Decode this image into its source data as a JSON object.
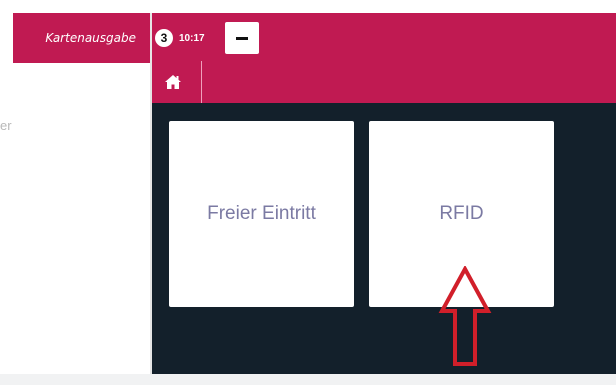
{
  "sidebar": {
    "title": "Kartenausgabe",
    "partial_text": "er"
  },
  "header": {
    "badge_count": "3",
    "time": "10:17",
    "minus_icon": "minus-icon",
    "home_icon": "home-icon"
  },
  "tiles": [
    {
      "label": "Freier Eintritt"
    },
    {
      "label": "RFID"
    }
  ],
  "annotation": {
    "arrow_icon": "up-arrow-icon",
    "arrow_color": "#d11f2a"
  },
  "colors": {
    "brand": "#c01a52",
    "main_bg": "#13202b",
    "tile_text": "#7b7aa3"
  }
}
